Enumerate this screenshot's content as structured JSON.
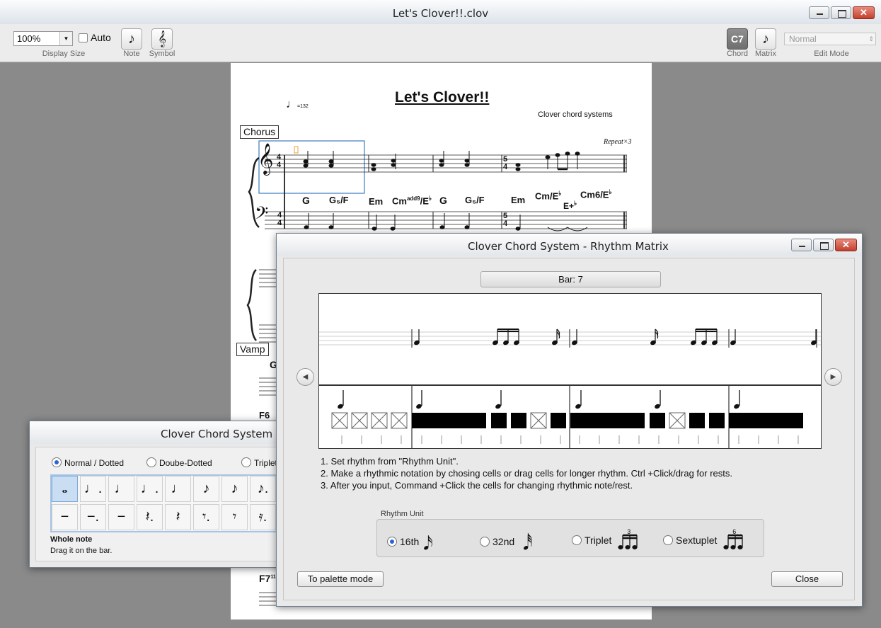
{
  "main_window": {
    "title": "Let's Clover!!.clov",
    "toolbar": {
      "zoom_value": "100%",
      "auto_label": "Auto",
      "display_size_label": "Display Size",
      "note_label": "Note",
      "symbol_label": "Symbol",
      "chord_button": "C7",
      "chord_label": "Chord",
      "matrix_label": "Matrix",
      "edit_mode_value": "Normal",
      "edit_mode_label": "Edit Mode"
    }
  },
  "score": {
    "title": "Let's Clover!!",
    "tempo": "=132",
    "composer": "Clover chord systems",
    "section_chorus": "Chorus",
    "section_vamp": "Vamp",
    "repeat_mark": "Repeat×3",
    "time_sig_1": "4",
    "time_sig_2": "5",
    "chords": [
      "G",
      "G₅/F",
      "Em",
      "Cm",
      "add9",
      "/E",
      "♭",
      "G",
      "G₅/F",
      "Em",
      "Cm",
      "/E",
      "♭",
      "E+",
      "♭",
      "Cm6",
      "/E",
      "♭"
    ],
    "vamp_chord": "G",
    "lower_chord_1": "F6",
    "lower_chord_2": "F7",
    "lower_chord_2_sup": "11 9"
  },
  "palette_window": {
    "title": "Clover Chord System - Palette",
    "options": [
      "Normal / Dotted",
      "Doube-Dotted",
      "Triplet"
    ],
    "notes": [
      "𝅝",
      "♩.",
      "♩",
      "♩.",
      "♩",
      "♪",
      "♪",
      "♪."
    ],
    "rests": [
      "−",
      "−.",
      "−",
      "𝄽.",
      "𝄽",
      "𝄾.",
      "𝄾",
      "𝄿."
    ],
    "selected_name": "Whole note",
    "hint": "Drag it on the bar."
  },
  "matrix_window": {
    "title": "Clover Chord System -  Rhythm Matrix",
    "bar_label": "Bar:  7",
    "instructions": [
      "1. Set rhythm from \"Rhythm Unit\".",
      "2. Make a rhythmic notation by chosing cells or drag cells for longer rhythm. Ctrl +Click/drag for rests.",
      "3.  After you input, Command +Click the cells for changing rhythmic note/rest."
    ],
    "rhythm_unit_label": "Rhythm Unit",
    "units": [
      {
        "label": "16th",
        "selected": true
      },
      {
        "label": "32nd",
        "selected": false
      },
      {
        "label": "Triplet",
        "selected": false,
        "tuplet": "3"
      },
      {
        "label": "Sextuplet",
        "selected": false,
        "tuplet": "6"
      }
    ],
    "palette_mode_button": "To palette mode",
    "close_button": "Close"
  }
}
